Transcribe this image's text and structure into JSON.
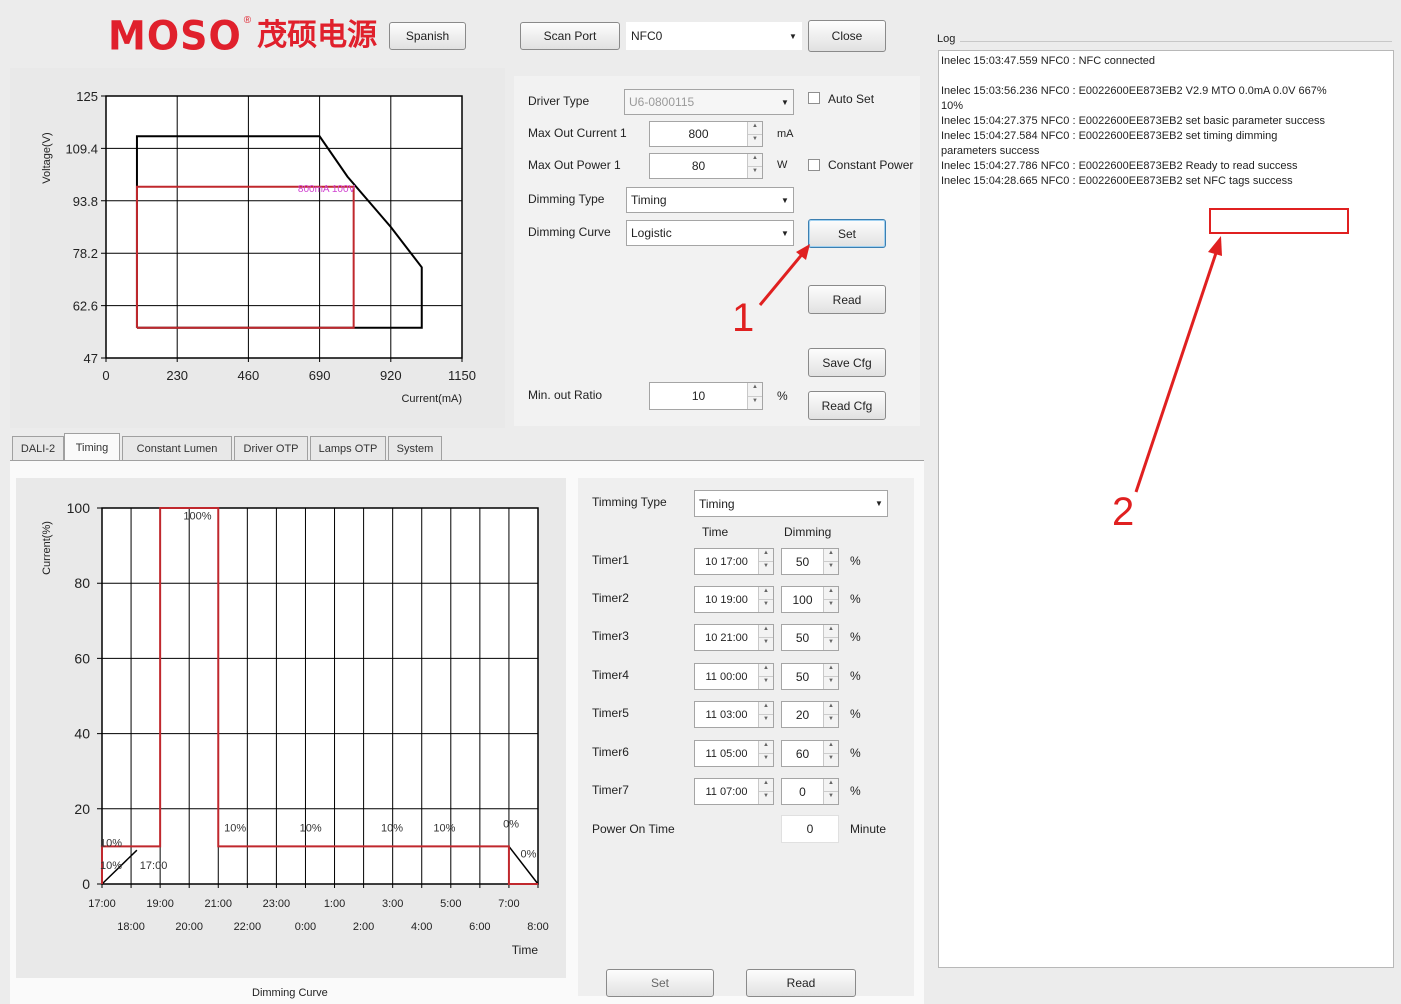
{
  "header": {
    "logo_text": "MOSO",
    "logo_reg": "®",
    "logo_cn": "茂硕电源",
    "language_button": "Spanish",
    "scan_port_button": "Scan Port",
    "port_value": "NFC0",
    "close_button": "Close"
  },
  "driver": {
    "driver_type_label": "Driver Type",
    "driver_type_value": "U6-0800115",
    "auto_set_label": "Auto Set",
    "max_current_label": "Max Out Current 1",
    "max_current_value": "800",
    "max_current_unit": "mA",
    "max_power_label": "Max Out Power 1",
    "max_power_value": "80",
    "max_power_unit": "W",
    "constant_power_label": "Constant Power",
    "dimming_type_label": "Dimming Type",
    "dimming_type_value": "Timing",
    "dimming_curve_label": "Dimming Curve",
    "dimming_curve_value": "Logistic",
    "set_button": "Set",
    "read_button": "Read",
    "save_cfg_button": "Save Cfg",
    "read_cfg_button": "Read Cfg",
    "min_out_ratio_label": "Min. out Ratio",
    "min_out_ratio_value": "10",
    "min_out_ratio_unit": "%"
  },
  "annotations": {
    "marker_1": "1",
    "marker_2": "2",
    "color": "#e02020"
  },
  "tabs": [
    {
      "label": "DALI-2"
    },
    {
      "label": "Timing"
    },
    {
      "label": "Constant Lumen"
    },
    {
      "label": "Driver OTP"
    },
    {
      "label": "Lamps OTP"
    },
    {
      "label": "System"
    }
  ],
  "timing": {
    "timing_type_label": "Timming Type",
    "timing_type_value": "Timing",
    "col_time": "Time",
    "col_dimming": "Dimming",
    "timers": [
      {
        "label": "Timer1",
        "time": "10 17:00",
        "dim": "50",
        "unit": "%"
      },
      {
        "label": "Timer2",
        "time": "10 19:00",
        "dim": "100",
        "unit": "%"
      },
      {
        "label": "Timer3",
        "time": "10 21:00",
        "dim": "50",
        "unit": "%"
      },
      {
        "label": "Timer4",
        "time": "11 00:00",
        "dim": "50",
        "unit": "%"
      },
      {
        "label": "Timer5",
        "time": "11 03:00",
        "dim": "20",
        "unit": "%"
      },
      {
        "label": "Timer6",
        "time": "11 05:00",
        "dim": "60",
        "unit": "%"
      },
      {
        "label": "Timer7",
        "time": "11 07:00",
        "dim": "0",
        "unit": "%"
      }
    ],
    "power_on_label": "Power On Time",
    "power_on_value": "0",
    "power_on_unit": "Minute",
    "set_button": "Set",
    "read_button": "Read"
  },
  "log": {
    "title": "Log",
    "lines": [
      "Inelec 15:03:47.559 NFC0 : NFC connected",
      "",
      "Inelec 15:03:56.236 NFC0 : E0022600EE873EB2  V2.9 MTO   0.0mA  0.0V 667%",
      "10%",
      "Inelec 15:04:27.375 NFC0 : E0022600EE873EB2 set basic parameter  success",
      "Inelec 15:04:27.584 NFC0 : E0022600EE873EB2 set timing dimming",
      "parameters  success",
      "Inelec 15:04:27.786 NFC0 : E0022600EE873EB2 Ready to read success",
      "Inelec 15:04:28.665 NFC0 : E0022600EE873EB2 set  NFC tags  success"
    ]
  },
  "chart_data": [
    {
      "type": "line",
      "title": "",
      "xlabel": "Current(mA)",
      "ylabel": "Voltage(V)",
      "x_ticks": [
        "0",
        "230",
        "460",
        "690",
        "920",
        "1150"
      ],
      "y_ticks": [
        "47",
        "62.6",
        "78.2",
        "93.8",
        "109.4",
        "125"
      ],
      "xlim": [
        0,
        1150
      ],
      "ylim": [
        47,
        125
      ],
      "annotation": "800mA 100V",
      "series": [
        {
          "color": "#000000",
          "x": [
            100,
            100,
            690,
            780,
            920,
            1020,
            1020,
            100
          ],
          "y": [
            56,
            113,
            113,
            101,
            86,
            74,
            56,
            56
          ]
        },
        {
          "color": "#c0282d",
          "x": [
            100,
            100,
            800,
            800,
            100
          ],
          "y": [
            56,
            98,
            98,
            56,
            56
          ]
        }
      ]
    },
    {
      "type": "line",
      "title": "Dimming Curve",
      "xlabel": "Time",
      "ylabel": "Current(%)",
      "ylim": [
        0,
        100
      ],
      "y_ticks": [
        "0",
        "20",
        "40",
        "60",
        "80",
        "100"
      ],
      "x_ticks_top": [
        "17:00",
        "19:00",
        "21:00",
        "23:00",
        "1:00",
        "3:00",
        "5:00",
        "7:00"
      ],
      "x_ticks_bottom": [
        "18:00",
        "20:00",
        "22:00",
        "0:00",
        "2:00",
        "4:00",
        "6:00",
        "8:00"
      ],
      "series": [
        {
          "color": "#c0282d",
          "x": [
            17.0,
            17.0,
            18.0,
            18.0,
            19.0,
            19.0,
            21.0,
            21.0,
            24.0,
            27.0,
            29.0,
            31.0,
            31.0,
            32.0
          ],
          "y": [
            0,
            10,
            10,
            10,
            10,
            100,
            100,
            10,
            10,
            10,
            10,
            10,
            0,
            0
          ]
        }
      ],
      "labels": [
        "10%",
        "100%",
        "10%",
        "10%",
        "10%",
        "10%",
        "0%",
        "0%",
        "10%",
        "17:00"
      ]
    }
  ]
}
